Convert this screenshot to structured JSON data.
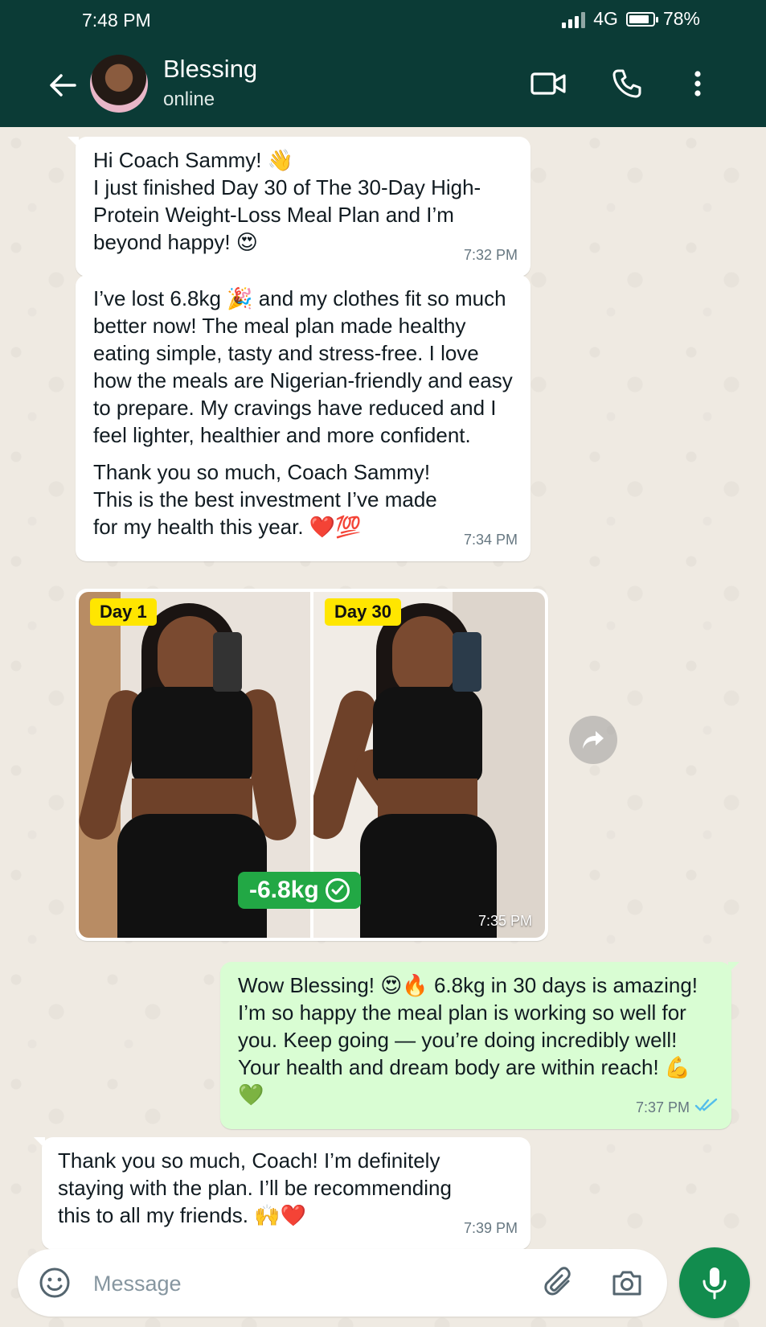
{
  "status_bar": {
    "time": "7:48 PM",
    "network": "4G",
    "battery": "78%",
    "battery_level": 0.78
  },
  "header": {
    "contact_name": "Blessing",
    "contact_status": "online",
    "icons": [
      "back-arrow-icon",
      "video-call-icon",
      "phone-icon",
      "more-vert-icon"
    ]
  },
  "messages": [
    {
      "direction": "incoming",
      "paragraphs": [
        "Hi Coach Sammy! 👋",
        "I just finished Day 30 of The 30-Day High-Protein Weight-Loss Meal Plan and I’m beyond happy! 😍"
      ],
      "time": "7:32 PM"
    },
    {
      "direction": "incoming",
      "paragraphs": [
        "I’ve lost 6.8kg 🎉 and my clothes fit so much better now! The meal plan made healthy eating simple, tasty and stress-free. I love how the meals are Nigerian-friendly and easy to prepare. My cravings have reduced and I feel lighter, healthier and more confident.",
        "Thank you so much, Coach Sammy! This is the best investment I’ve made for my health this year. ❤️💯"
      ],
      "time": "7:34 PM"
    },
    {
      "direction": "incoming",
      "type": "image",
      "left_label": "Day 1",
      "right_label": "Day 30",
      "badge": "-6.8kg",
      "time": "7:35 PM"
    },
    {
      "direction": "outgoing",
      "paragraphs": [
        "Wow Blessing! 😍🔥 6.8kg in 30 days is amazing! I’m so happy the meal plan is working so well for you. Keep going — you’re doing incredibly well! Your health and dream body are within reach! 💪💚"
      ],
      "time": "7:37 PM",
      "read": true
    },
    {
      "direction": "incoming",
      "paragraphs": [
        "Thank you so much, Coach! I’m definitely staying with the plan. I’ll be recommending this to all my friends. 🙌❤️"
      ],
      "time": "7:39 PM"
    }
  ],
  "composer": {
    "placeholder": "Message",
    "icons": [
      "emoji-icon",
      "attach-icon",
      "camera-icon",
      "mic-icon"
    ]
  },
  "colors": {
    "header_bg": "#0B3B36",
    "outgoing_bubble": "#D9FDD3",
    "incoming_bubble": "#FFFFFF",
    "chat_bg": "#EFEAE2",
    "mic_button": "#128C4E",
    "read_ticks": "#53BDEB",
    "day_label": "#FFE600",
    "badge_green": "#22A845"
  }
}
